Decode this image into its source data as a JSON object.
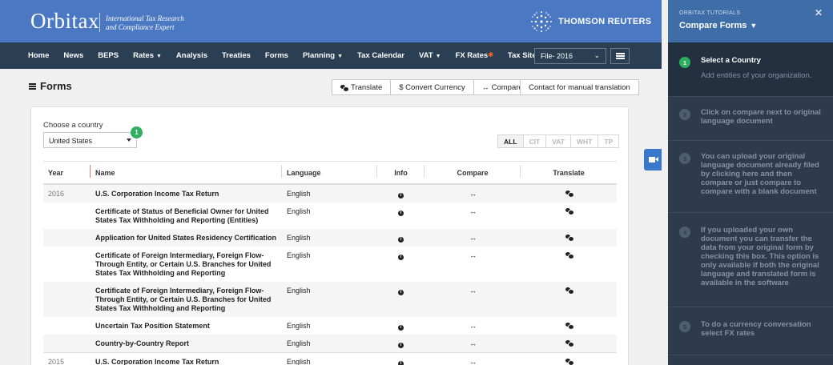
{
  "brand": {
    "logo": "Orbitax",
    "tagline_line1": "International Tax Research",
    "tagline_line2": "and Compliance Expert",
    "partner": "THOMSON REUTERS"
  },
  "nav": {
    "items": [
      "Home",
      "News",
      "BEPS",
      "Rates",
      "Analysis",
      "Treaties",
      "Forms",
      "Planning",
      "Tax Calendar",
      "VAT",
      "FX Rates",
      "Tax Sites"
    ],
    "file_select": "File- 2016"
  },
  "page": {
    "title": "Forms",
    "buttons": {
      "translate": "Translate",
      "convert": "$ Convert Currency",
      "compare": "Compare",
      "contact": "Contact for manual translation"
    }
  },
  "filter": {
    "label": "Choose a country",
    "country": "United States",
    "badge": "1",
    "options": [
      "ALL",
      "CIT",
      "VAT",
      "WHT",
      "TP"
    ],
    "active": "ALL"
  },
  "table": {
    "columns": [
      "Year",
      "Name",
      "Language",
      "Info",
      "Compare",
      "Translate"
    ],
    "rows": [
      {
        "year": "2016",
        "name": "U.S. Corporation Income Tax Return",
        "language": "English"
      },
      {
        "year": "",
        "name": "Certificate of Status of Beneficial Owner for United States Tax Withholding and Reporting (Entities)",
        "language": "English"
      },
      {
        "year": "",
        "name": "Application for United States Residency Certification",
        "language": "English"
      },
      {
        "year": "",
        "name": "Certificate of Foreign Intermediary, Foreign Flow-Through Entity, or Certain U.S. Branches for United States Tax Withholding and Reporting",
        "language": "English"
      },
      {
        "year": "",
        "name": "Certificate of Foreign Intermediary, Foreign Flow-Through Entity, or Certain U.S. Branches for United States Tax Withholding and Reporting",
        "language": "English"
      },
      {
        "year": "",
        "name": "Uncertain Tax Position Statement",
        "language": "English"
      },
      {
        "year": "",
        "name": "Country-by-Country Report",
        "language": "English"
      },
      {
        "year": "2015",
        "name": "U.S. Corporation Income Tax Return",
        "language": "English"
      }
    ]
  },
  "tutorial": {
    "label": "ORBITAX TUTORIALS",
    "title": "Compare Forms",
    "steps": [
      {
        "num": "1",
        "title": "Select a Country",
        "desc": "Add entities of your organization."
      },
      {
        "num": "2",
        "text": "Click on compare next to original language document"
      },
      {
        "num": "3",
        "text": "You can upload your original language document already filed by clicking here and then compare or just compare to compare with a blank document"
      },
      {
        "num": "4",
        "text": "If you uploaded your own document you can transfer the data from your original form by checking this box. This option is only available if both the original language and translated form is available in the software"
      },
      {
        "num": "5",
        "text": "To do a currency conversation select FX rates"
      }
    ]
  }
}
